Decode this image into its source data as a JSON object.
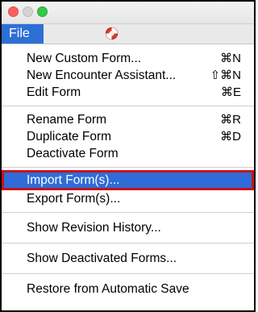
{
  "menubar": {
    "file_label": "File",
    "help_icon": "lifebuoy-icon"
  },
  "menu": {
    "group1": [
      {
        "label": "New Custom Form...",
        "shortcut": "⌘N"
      },
      {
        "label": "New Encounter Assistant...",
        "shortcut": "⇧⌘N"
      },
      {
        "label": "Edit Form",
        "shortcut": "⌘E"
      }
    ],
    "group2": [
      {
        "label": "Rename Form",
        "shortcut": "⌘R"
      },
      {
        "label": "Duplicate Form",
        "shortcut": "⌘D"
      },
      {
        "label": "Deactivate Form",
        "shortcut": ""
      }
    ],
    "group3": [
      {
        "label": "Import Form(s)...",
        "shortcut": "",
        "highlighted": true
      },
      {
        "label": "Export Form(s)...",
        "shortcut": ""
      }
    ],
    "group4": [
      {
        "label": "Show Revision History...",
        "shortcut": ""
      }
    ],
    "group5": [
      {
        "label": "Show Deactivated Forms...",
        "shortcut": ""
      }
    ],
    "group6": [
      {
        "label": "Restore from Automatic Save",
        "shortcut": ""
      }
    ]
  },
  "colors": {
    "highlight": "#2f6cd8",
    "highlight_border": "#c8131b"
  }
}
